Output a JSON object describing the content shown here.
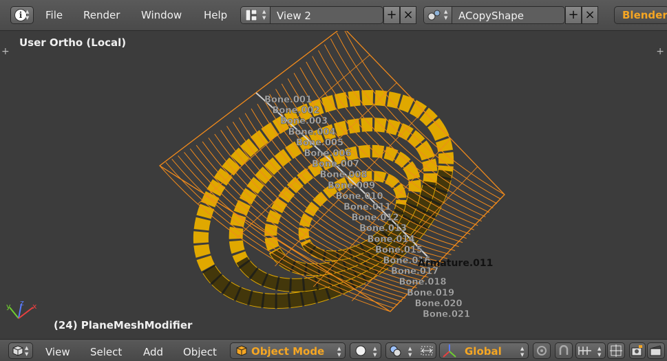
{
  "topbar": {
    "menu": [
      "File",
      "Render",
      "Window",
      "Help"
    ],
    "screen_name": "View 2",
    "scene_name": "ACopyShape",
    "engine": "Blender"
  },
  "viewport": {
    "view_title": "User Ortho (Local)",
    "active_object": "(24) PlaneMeshModifier",
    "bone_labels": [
      "Bone.001",
      "Bone.002",
      "Bone.003",
      "Bone.004",
      "Bone.005",
      "Bone.006",
      "Bone.007",
      "Bone.008",
      "Bone.009",
      "Bone.010",
      "Bone.011",
      "Bone.012",
      "Bone.013",
      "Bone.014",
      "Bone.015",
      "Bone.016",
      "Bone.017",
      "Bone.018",
      "Bone.019",
      "Bone.020",
      "Bone.021"
    ],
    "armature_label": "Armature.011",
    "axis_labels": {
      "x": "x",
      "y": "y",
      "z": "z"
    },
    "wire_color": "#f08a1c",
    "mesh_color": "#e0a800"
  },
  "bottombar": {
    "menu": [
      "View",
      "Select",
      "Add",
      "Object"
    ],
    "mode": "Object Mode",
    "orientation": "Global"
  }
}
